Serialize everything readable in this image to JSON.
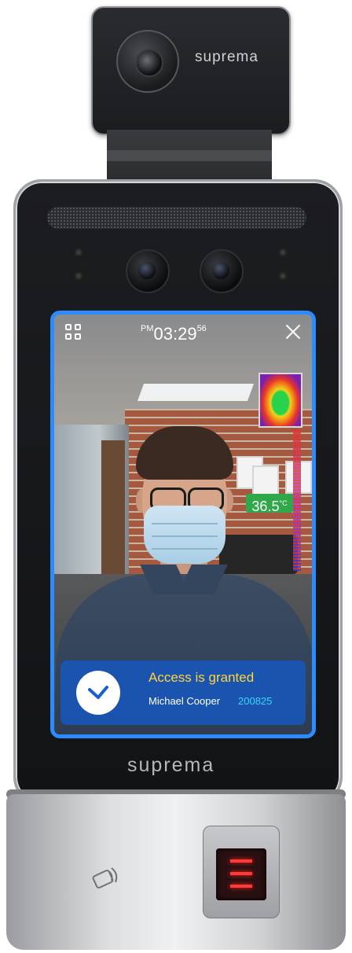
{
  "camera_module": {
    "brand": "suprema"
  },
  "device": {
    "brand": "suprema"
  },
  "screen": {
    "clock": {
      "ampm": "PM",
      "time": "03:29",
      "seconds": "56"
    },
    "temperature": {
      "value": "36.5",
      "unit": "°C"
    },
    "access": {
      "status": "Access is granted",
      "user_name": "Michael Cooper",
      "user_id": "200825"
    }
  },
  "colors": {
    "screen_border": "#2a8cff",
    "access_card": "#145ac8",
    "access_status": "#ffd43b",
    "user_id": "#3fd3ff",
    "temp_badge": "#2fa84a"
  },
  "icons": [
    "menu-icon",
    "close-icon",
    "check-icon",
    "nfc-icon",
    "fingerprint-sensor"
  ]
}
